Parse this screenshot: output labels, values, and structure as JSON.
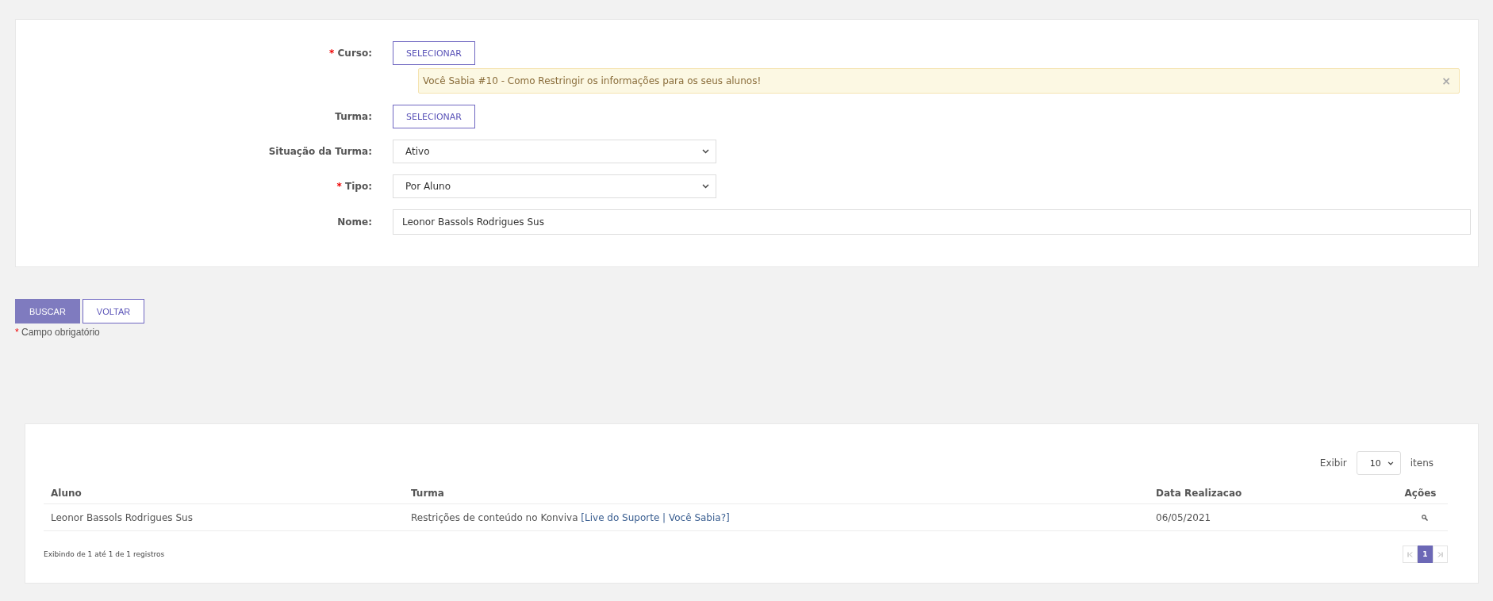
{
  "form": {
    "fields": [
      {
        "kind": "button",
        "label": "Curso:",
        "required": true,
        "value": "SELECIONAR",
        "alert": {
          "text": "Você Sabia #10 - Como Restringir os informações para os seus alunos!",
          "close": "×"
        }
      },
      {
        "kind": "button",
        "label": "Turma:",
        "required": false,
        "value": "SELECIONAR"
      },
      {
        "kind": "select",
        "label": "Situação da Turma:",
        "required": false,
        "value": "Ativo"
      },
      {
        "kind": "select",
        "label": "Tipo:",
        "required": true,
        "value": "Por Aluno"
      },
      {
        "kind": "input",
        "label": "Nome:",
        "required": false,
        "value": "Leonor Bassols Rodrigues Sus"
      }
    ]
  },
  "actions": [
    {
      "label": "BUSCAR",
      "primary": true
    },
    {
      "label": "VOLTAR",
      "primary": false
    }
  ],
  "required_note": {
    "mark": "*",
    "text": "Campo obrigatório"
  },
  "results": {
    "page_size": {
      "before": "Exibir",
      "value": "10",
      "after": "itens"
    },
    "columns": [
      "Aluno",
      "Turma",
      "Data Realizacao",
      "Ações"
    ],
    "rows": [
      {
        "aluno": "Leonor Bassols Rodrigues Sus",
        "turma": "Restrições de conteúdo no Konviva",
        "turma_link": "[Live do Suporte | Você Sabia?]",
        "data": "06/05/2021"
      }
    ],
    "summary": "Exibindo de 1 até 1 de 1 registros",
    "pagination": [
      {
        "kind": "first",
        "selected": false,
        "disabled": true
      },
      {
        "label": "1",
        "kind": "page",
        "selected": true,
        "disabled": false
      },
      {
        "kind": "last",
        "selected": false,
        "disabled": true
      }
    ]
  }
}
